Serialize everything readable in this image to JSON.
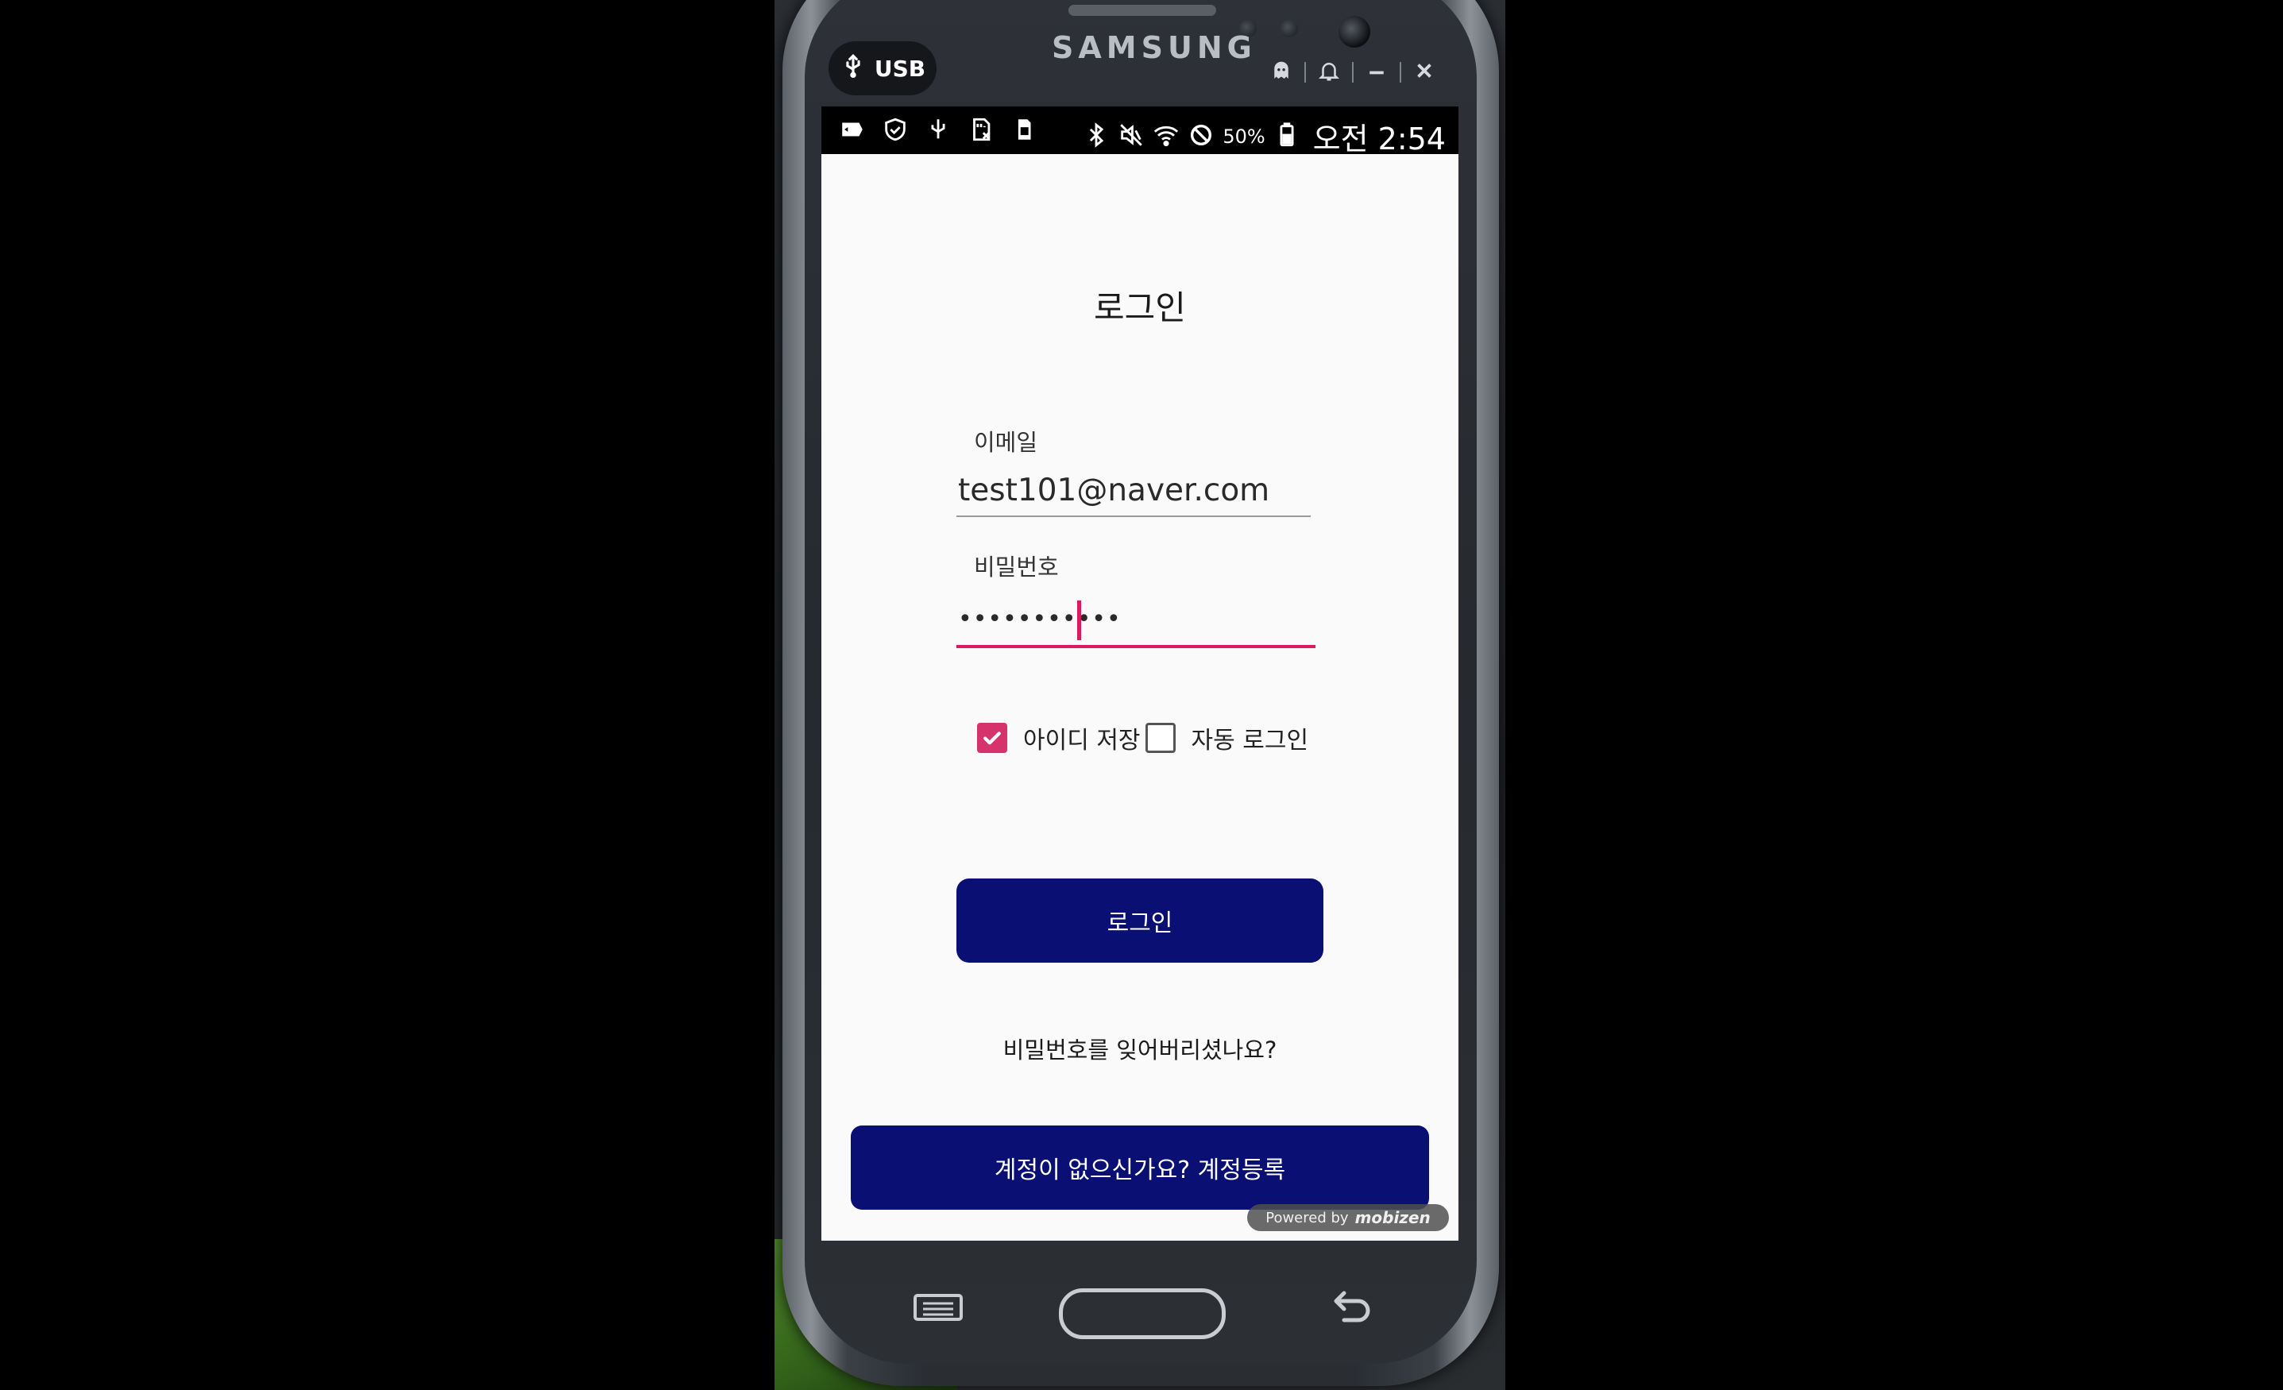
{
  "device": {
    "brand": "SAMSUNG",
    "usb_label": "USB"
  },
  "statusbar": {
    "battery_percent": "50%",
    "time": "오전 2:54",
    "left_icons": [
      "screen-mirror-icon",
      "shield-icon",
      "usb-icon",
      "sd-card-icon",
      "sim-icon"
    ],
    "right_icons": [
      "bluetooth-icon",
      "mute-icon",
      "wifi-icon",
      "blocked-icon",
      "battery-icon"
    ]
  },
  "login": {
    "title": "로그인",
    "email_label": "이메일",
    "email_value": "test101@naver.com",
    "password_label": "비밀번호",
    "password_value": "•••••••••••",
    "save_id_label": "아이디 저장",
    "save_id_checked": true,
    "auto_login_label": "자동 로그인",
    "auto_login_checked": false,
    "login_button": "로그인",
    "forgot_password": "비밀번호를 잊어버리셨나요?",
    "register_button": "계정이 없으신가요? 계정등록"
  },
  "watermark": {
    "prefix": "Powered by",
    "brand": "mobizen"
  },
  "colors": {
    "primary_button": "#0a0f73",
    "accent": "#d81b60",
    "checkbox": "#d6336c",
    "screen_bg": "#fafafa"
  }
}
